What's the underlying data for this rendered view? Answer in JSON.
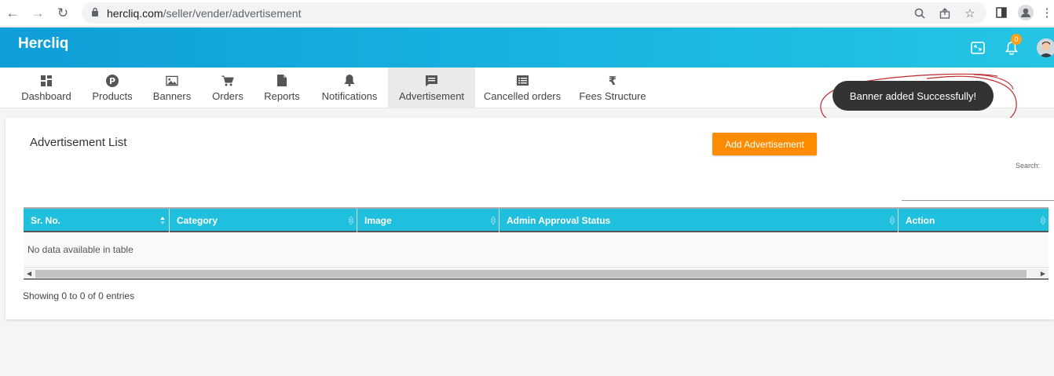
{
  "browser": {
    "url_host": "hercliq.com",
    "url_path": "/seller/vender/advertisement"
  },
  "header": {
    "brand": "Hercliq",
    "notification_count": "0"
  },
  "nav": {
    "items": [
      {
        "label": "Dashboard",
        "icon": "dashboard-icon"
      },
      {
        "label": "Products",
        "icon": "product-p-icon"
      },
      {
        "label": "Banners",
        "icon": "image-icon"
      },
      {
        "label": "Orders",
        "icon": "cart-icon"
      },
      {
        "label": "Reports",
        "icon": "file-icon"
      },
      {
        "label": "Notifications",
        "icon": "bell-icon"
      },
      {
        "label": "Advertisement",
        "icon": "message-icon"
      },
      {
        "label": "Cancelled orders",
        "icon": "list-icon"
      },
      {
        "label": "Fees Structure",
        "icon": "rupee-icon"
      }
    ],
    "active": "Advertisement"
  },
  "toast": {
    "message": "Banner added Successfully!"
  },
  "page": {
    "title": "Advertisement List",
    "add_button": "Add Advertisement",
    "search_label": "Search:"
  },
  "table": {
    "columns": [
      "Sr. No.",
      "Category",
      "Image",
      "Admin Approval Status",
      "Action"
    ],
    "empty_message": "No data available in table",
    "info": "Showing 0 to 0 of 0 entries"
  },
  "colors": {
    "header_gradient_start": "#0f9ed8",
    "header_gradient_end": "#25c4e3",
    "table_header": "#1fbfdd",
    "primary_button": "#ff8c00",
    "toast_bg": "#333333",
    "badge": "#ff9f1a"
  }
}
